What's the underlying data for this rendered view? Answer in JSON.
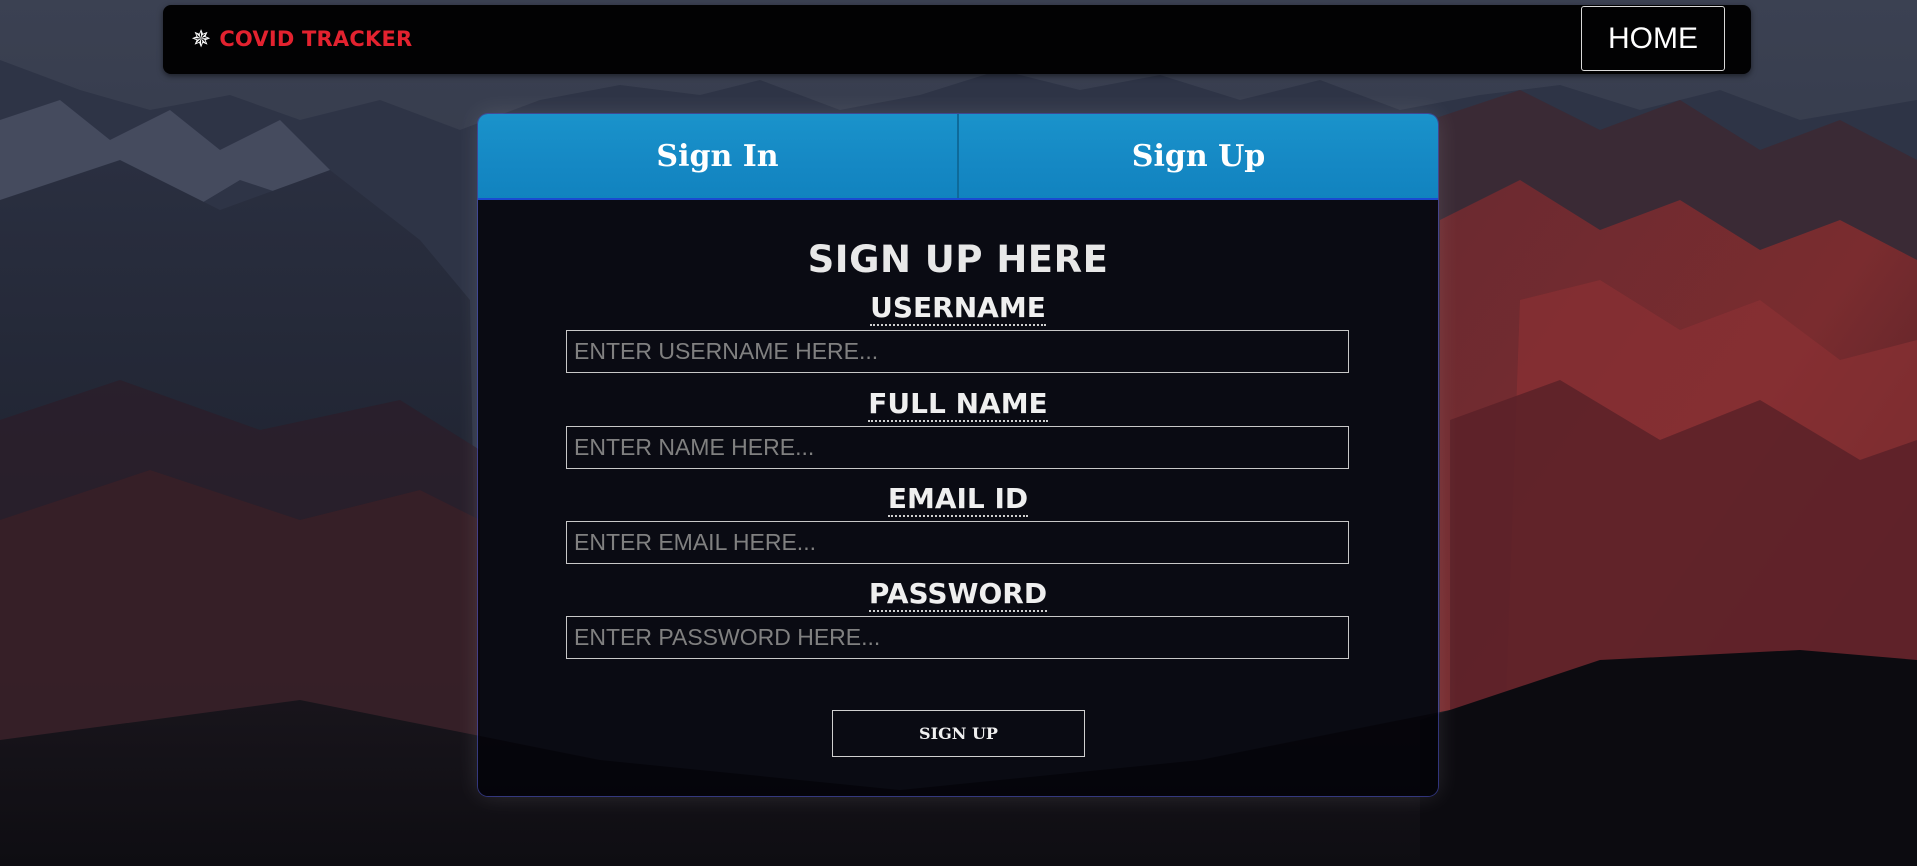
{
  "navbar": {
    "brand_icon": "virus-icon",
    "brand_text": "COVID TRACKER",
    "brand_color": "#e3222f",
    "home_label": "HOME"
  },
  "tabs": {
    "sign_in_label": "Sign In",
    "sign_up_label": "Sign Up",
    "accent": "#1588c4"
  },
  "form": {
    "title": "SIGN UP HERE",
    "fields": [
      {
        "label": "USERNAME",
        "placeholder": "ENTER USERNAME HERE...",
        "value": ""
      },
      {
        "label": "FULL NAME",
        "placeholder": "ENTER NAME HERE...",
        "value": ""
      },
      {
        "label": "EMAIL ID",
        "placeholder": "ENTER EMAIL HERE...",
        "value": ""
      },
      {
        "label": "PASSWORD",
        "placeholder": "ENTER PASSWORD HERE...",
        "value": ""
      }
    ],
    "submit_label": "SIGN UP"
  }
}
